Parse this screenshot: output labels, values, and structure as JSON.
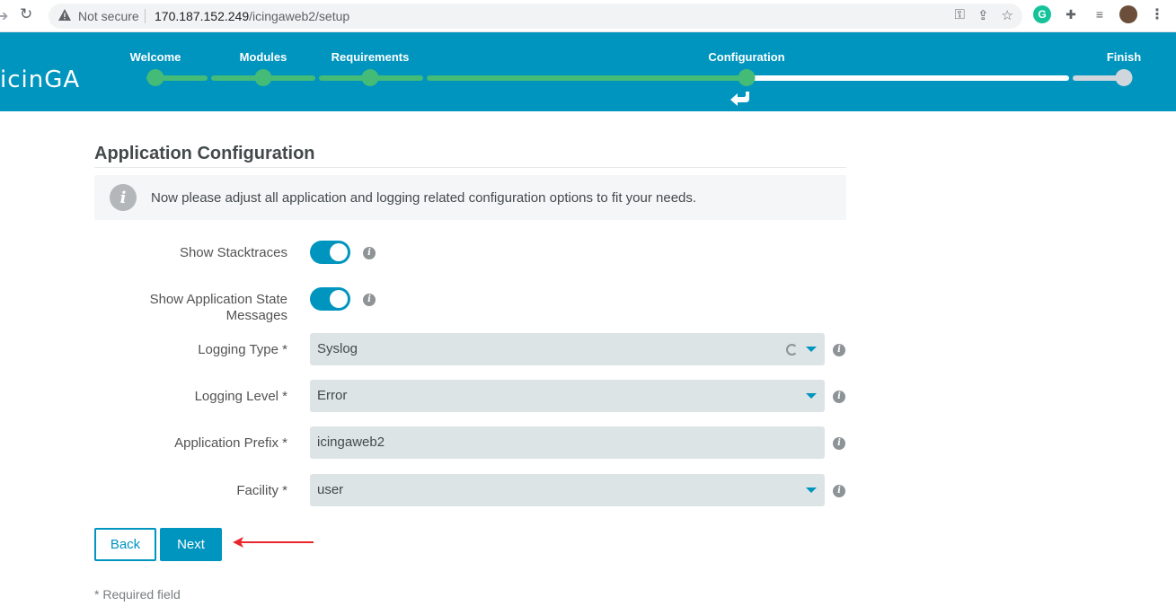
{
  "browser": {
    "security": "Not secure",
    "url_host": "170.187.152.249",
    "url_path": "/icingaweb2/setup"
  },
  "header": {
    "logo": "icinGA",
    "steps": [
      {
        "label": "Welcome",
        "state": "done"
      },
      {
        "label": "Modules",
        "state": "done"
      },
      {
        "label": "Requirements",
        "state": "done"
      },
      {
        "label": "Configuration",
        "state": "current"
      },
      {
        "label": "Finish",
        "state": "pending"
      }
    ],
    "colors": {
      "background": "#0095bf",
      "done": "#44bb77",
      "pending": "#cfd6dc"
    }
  },
  "page": {
    "title": "Application Configuration",
    "info": "Now please adjust all application and logging related configuration options to fit your needs."
  },
  "form": {
    "show_stacktraces": {
      "label": "Show Stacktraces",
      "checked": true
    },
    "show_state_messages": {
      "label_line1": "Show Application State",
      "label_line2": "Messages",
      "checked": true
    },
    "logging_type": {
      "label": "Logging Type *",
      "value": "Syslog"
    },
    "logging_level": {
      "label": "Logging Level *",
      "value": "Error"
    },
    "app_prefix": {
      "label": "Application Prefix *",
      "value": "icingaweb2"
    },
    "facility": {
      "label": "Facility *",
      "value": "user"
    }
  },
  "buttons": {
    "back": "Back",
    "next": "Next"
  },
  "required_note": "* Required field",
  "accent": "#0095bf"
}
